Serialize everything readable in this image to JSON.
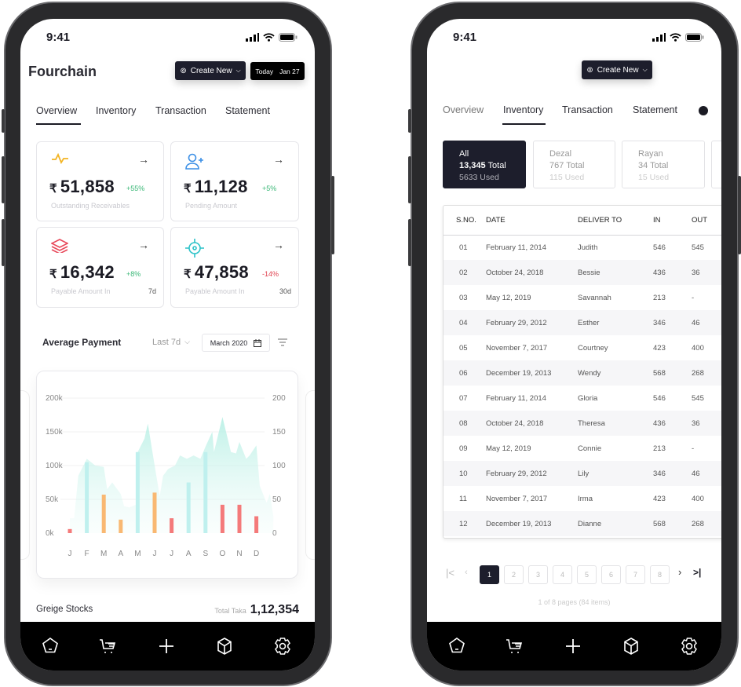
{
  "status_time": "9:41",
  "overview_screen": {
    "logo": "Fourchain",
    "create_new": "Create New",
    "today_label": "Today",
    "today_date": "Jan 27",
    "tabs": [
      "Overview",
      "Inventory",
      "Transaction",
      "Statement"
    ],
    "active_tab": "Overview",
    "cards": [
      {
        "icon": "pulse-icon",
        "amount": "51,858",
        "change": "+55%",
        "label": "Outstanding Receivables",
        "period": "",
        "trend": "up"
      },
      {
        "icon": "user-plus-icon",
        "amount": "11,128",
        "change": "+5%",
        "label": "Pending Amount",
        "period": "",
        "trend": "up"
      },
      {
        "icon": "layers-icon",
        "amount": "16,342",
        "change": "+8%",
        "label": "Payable Amount In",
        "period": "7d",
        "trend": "up"
      },
      {
        "icon": "crosshair-icon",
        "amount": "47,858",
        "change": "-14%",
        "label": "Payable Amount In",
        "period": "30d",
        "trend": "down"
      }
    ],
    "currency": "₹",
    "avg_payment": {
      "title": "Average Payment",
      "range": "Last 7d",
      "date": "March 2020"
    },
    "greige": {
      "title": "Greige Stocks",
      "total_label": "Total Taka",
      "total_value": "1,12,354"
    }
  },
  "chart_data": {
    "type": "bar+area",
    "categories": [
      "J",
      "F",
      "M",
      "A",
      "M",
      "J",
      "J",
      "A",
      "S",
      "O",
      "N",
      "D"
    ],
    "left_axis": {
      "ticks": [
        "0k",
        "50k",
        "100k",
        "150k",
        "200k"
      ],
      "range": [
        0,
        200000
      ]
    },
    "right_axis": {
      "ticks": [
        "0",
        "50",
        "100",
        "150",
        "200"
      ],
      "range": [
        0,
        200
      ]
    },
    "bars": [
      {
        "value": 6,
        "color": "#f47a7a"
      },
      {
        "value": 105,
        "color": "#bff0ee"
      },
      {
        "value": 57,
        "color": "#f9b872"
      },
      {
        "value": 20,
        "color": "#f9b872"
      },
      {
        "value": 120,
        "color": "#bff0ee"
      },
      {
        "value": 60,
        "color": "#f9b872"
      },
      {
        "value": 22,
        "color": "#f47a7a"
      },
      {
        "value": 75,
        "color": "#bff0ee"
      },
      {
        "value": 120,
        "color": "#bff0ee"
      },
      {
        "value": 42,
        "color": "#f47a7a"
      },
      {
        "value": 42,
        "color": "#f47a7a"
      },
      {
        "value": 25,
        "color": "#f47a7a"
      }
    ],
    "area": [
      [
        0,
        22
      ],
      [
        0.25,
        22
      ],
      [
        0.5,
        85
      ],
      [
        1,
        110
      ],
      [
        1.5,
        100
      ],
      [
        2,
        98
      ],
      [
        2.2,
        65
      ],
      [
        2.5,
        75
      ],
      [
        3,
        58
      ],
      [
        3.2,
        40
      ],
      [
        3.5,
        38
      ],
      [
        3.9,
        42
      ],
      [
        4,
        120
      ],
      [
        4.4,
        140
      ],
      [
        4.6,
        162
      ],
      [
        5,
        100
      ],
      [
        5.3,
        55
      ],
      [
        5.5,
        85
      ],
      [
        5.8,
        95
      ],
      [
        6.2,
        100
      ],
      [
        6.5,
        115
      ],
      [
        6.9,
        110
      ],
      [
        7.3,
        115
      ],
      [
        7.7,
        110
      ],
      [
        8,
        128
      ],
      [
        8.4,
        150
      ],
      [
        8.5,
        120
      ],
      [
        9,
        172
      ],
      [
        9.5,
        120
      ],
      [
        9.8,
        118
      ],
      [
        10,
        135
      ],
      [
        10.4,
        110
      ],
      [
        10.6,
        115
      ],
      [
        11,
        130
      ],
      [
        11.2,
        70
      ],
      [
        11.6,
        45
      ],
      [
        11.8,
        58
      ],
      [
        12,
        25
      ]
    ]
  },
  "inventory_screen": {
    "create_new": "Create New",
    "tabs": [
      "Overview",
      "Inventory",
      "Transaction",
      "Statement"
    ],
    "active_tab": "Inventory",
    "filters": [
      {
        "name": "All",
        "total": "13,345",
        "total_label": "Total",
        "used": "5633 Used",
        "active": true
      },
      {
        "name": "Dezal",
        "total": "767",
        "total_label": "Total",
        "used": "115 Used",
        "active": false
      },
      {
        "name": "Rayan",
        "total": "34",
        "total_label": "Total",
        "used": "15 Used",
        "active": false
      }
    ],
    "table": {
      "headers": [
        "S.NO.",
        "DATE",
        "DELIVER TO",
        "IN",
        "OUT"
      ],
      "rows": [
        [
          "01",
          "February 11, 2014",
          "Judith",
          "546",
          "545"
        ],
        [
          "02",
          "October 24, 2018",
          "Bessie",
          "436",
          "36"
        ],
        [
          "03",
          "May 12, 2019",
          "Savannah",
          "213",
          "-"
        ],
        [
          "04",
          "February 29, 2012",
          "Esther",
          "346",
          "46"
        ],
        [
          "05",
          "November 7, 2017",
          "Courtney",
          "423",
          "400"
        ],
        [
          "06",
          "December 19, 2013",
          "Wendy",
          "568",
          "268"
        ],
        [
          "07",
          "February 11, 2014",
          "Gloria",
          "546",
          "545"
        ],
        [
          "08",
          "October 24, 2018",
          "Theresa",
          "436",
          "36"
        ],
        [
          "09",
          "May 12, 2019",
          "Connie",
          "213",
          "-"
        ],
        [
          "10",
          "February 29, 2012",
          "Lily",
          "346",
          "46"
        ],
        [
          "11",
          "November 7, 2017",
          "Irma",
          "423",
          "400"
        ],
        [
          "12",
          "December 19, 2013",
          "Dianne",
          "568",
          "268"
        ]
      ]
    },
    "pagination": {
      "pages": [
        "1",
        "2",
        "3",
        "4",
        "5",
        "6",
        "7",
        "8"
      ],
      "current": "1",
      "summary": "1 of 8 pages (84 items)"
    }
  },
  "nav_icons": [
    "home-icon",
    "cart-icon",
    "plus-icon",
    "box-icon",
    "settings-icon"
  ]
}
